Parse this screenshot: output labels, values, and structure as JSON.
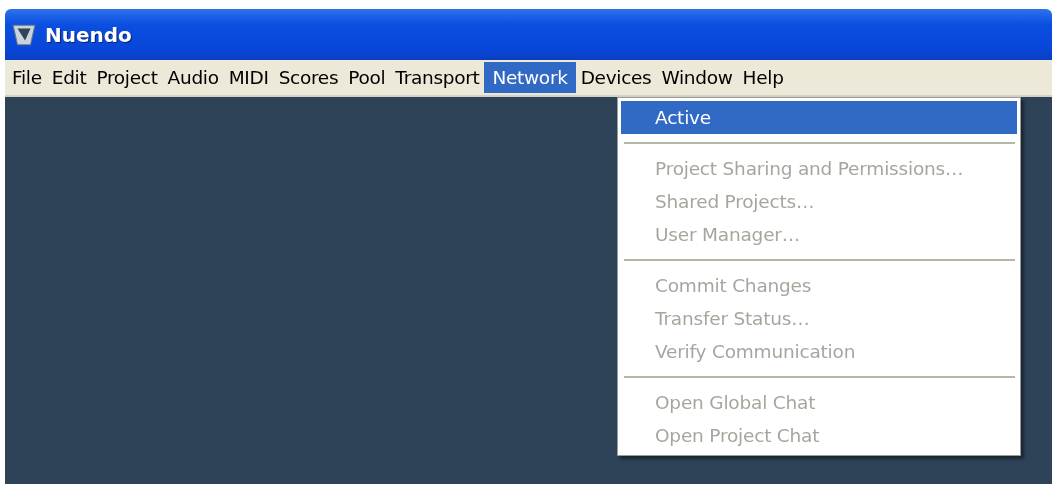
{
  "window": {
    "title": "Nuendo"
  },
  "menu_bar": [
    {
      "label": "File",
      "selected": false
    },
    {
      "label": "Edit",
      "selected": false
    },
    {
      "label": "Project",
      "selected": false
    },
    {
      "label": "Audio",
      "selected": false
    },
    {
      "label": "MIDI",
      "selected": false
    },
    {
      "label": "Scores",
      "selected": false
    },
    {
      "label": "Pool",
      "selected": false
    },
    {
      "label": "Transport",
      "selected": false
    },
    {
      "label": "Network",
      "selected": true
    },
    {
      "label": "Devices",
      "selected": false
    },
    {
      "label": "Window",
      "selected": false
    },
    {
      "label": "Help",
      "selected": false
    }
  ],
  "menu": [
    {
      "kind": "item",
      "label": "Active",
      "disabled": false,
      "selected": true
    },
    {
      "kind": "separator"
    },
    {
      "kind": "item",
      "label": "Project Sharing and Permissions…",
      "disabled": true,
      "selected": false
    },
    {
      "kind": "item",
      "label": "Shared Projects…",
      "disabled": true,
      "selected": false
    },
    {
      "kind": "item",
      "label": "User Manager…",
      "disabled": true,
      "selected": false
    },
    {
      "kind": "separator"
    },
    {
      "kind": "item",
      "label": "Commit Changes",
      "disabled": true,
      "selected": false
    },
    {
      "kind": "item",
      "label": "Transfer Status…",
      "disabled": true,
      "selected": false
    },
    {
      "kind": "item",
      "label": "Verify Communication",
      "disabled": true,
      "selected": false
    },
    {
      "kind": "separator"
    },
    {
      "kind": "item",
      "label": "Open Global Chat",
      "disabled": true,
      "selected": false
    },
    {
      "kind": "item",
      "label": "Open Project Chat",
      "disabled": true,
      "selected": false
    }
  ]
}
